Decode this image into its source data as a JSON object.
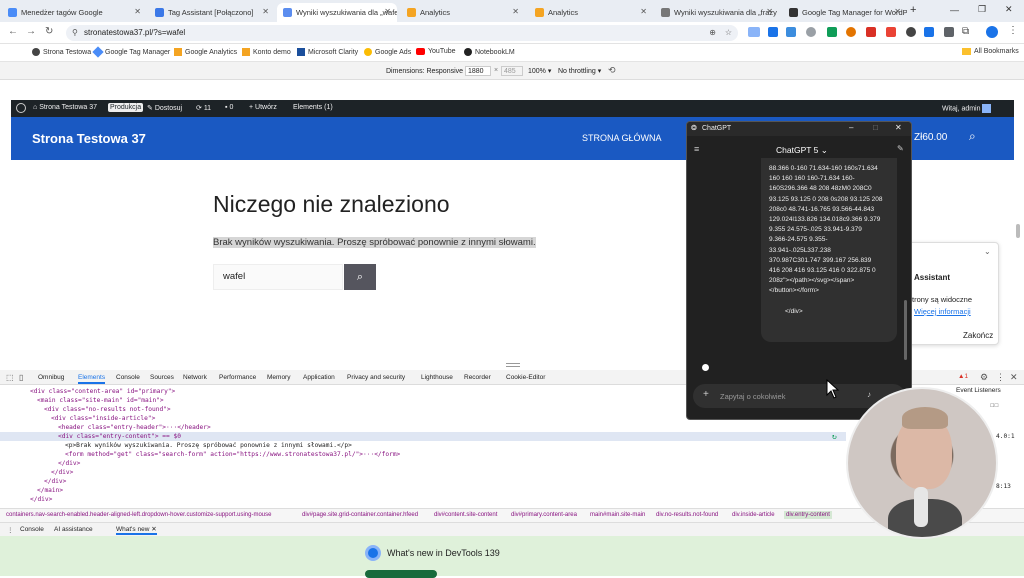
{
  "tabs": [
    {
      "label": "Menedżer tagów Google",
      "color": "#4a8cf7"
    },
    {
      "label": "Tag Assistant [Połączono]",
      "color": "#3b78e7"
    },
    {
      "label": "Wyniki wyszukiwania dla „wafel",
      "color": "#5b8def"
    },
    {
      "label": "Analytics",
      "color": "#f4a422"
    },
    {
      "label": "Analytics",
      "color": "#f4a422"
    },
    {
      "label": "Wyniki wyszukiwania dla „frazy",
      "color": "#777777"
    },
    {
      "label": "Google Tag Manager for WordPr",
      "color": "#333333"
    }
  ],
  "address": {
    "url": "stronatestowa37.pl/?s=wafel"
  },
  "bookmarks": [
    "Strona Testowa",
    "Google Tag Manager",
    "Google Analytics",
    "Konto demo",
    "Microsoft Clarity",
    "Google Ads",
    "YouTube",
    "NotebookLM"
  ],
  "all_bookmarks": "All Bookmarks",
  "device": {
    "dimensions": "Dimensions: Responsive",
    "width": "1880",
    "height": "485",
    "zoom": "100%",
    "throttle": "No throttling"
  },
  "wpbar": {
    "site": "Strona Testowa 37",
    "badge": "Produkcja",
    "customize": "Dostosuj",
    "updates": "11",
    "comments": "0",
    "new": "Utwórz",
    "elements": "Elements (1)",
    "greeting": "Witaj, admin"
  },
  "site": {
    "title": "Strona Testowa 37",
    "nav": "STRONA GŁÓWNA",
    "cart": "Zł60.00"
  },
  "page": {
    "heading": "Niczego nie znaleziono",
    "message": "Brak wyników wyszukiwania. Proszę spróbować ponownie z innymi słowami.",
    "search_value": "wafel"
  },
  "assistant": {
    "title": "Assistant",
    "line1": "trony są widoczne",
    "link": "Więcej informacji",
    "end": "Zakończ"
  },
  "devtools": {
    "tabs": [
      "Omnibug",
      "Elements",
      "Console",
      "Sources",
      "Network",
      "Performance",
      "Memory",
      "Application",
      "Privacy and security",
      "Lighthouse",
      "Recorder",
      "Cookie-Editor"
    ],
    "issues": "1",
    "event_listeners": "Event Listeners",
    "dom_lines": [
      "<div class=\"content-area\" id=\"primary\">",
      "<main class=\"site-main\" id=\"main\">",
      "<div class=\"no-results not-found\">",
      "<div class=\"inside-article\">",
      "<header class=\"entry-header\">···</header>",
      "<div class=\"entry-content\"> == $0",
      "<p>Brak wyników wyszukiwania. Proszę spróbować ponownie z innymi słowami.</p>",
      "<form method=\"get\" class=\"search-form\" action=\"https://www.stronatestowa37.pl/\">···</form>",
      "</div>",
      "</div>",
      "</div>",
      "</main>",
      "</div>"
    ],
    "side_values": [
      "4.0:1",
      "8:13"
    ],
    "breadcrumbs": [
      "containers.nav-search-enabled.header-aligned-left.dropdown-hover.customize-support.using-mouse",
      "div#page.site.grid-container.container.hfeed",
      "div#content.site-content",
      "div#primary.content-area",
      "main#main.site-main",
      "div.no-results.not-found",
      "div.inside-article",
      "div.entry-content"
    ],
    "drawer_tabs": [
      "Console",
      "AI assistance",
      "What's new"
    ],
    "whats_new": "What's new in DevTools 139"
  },
  "chatgpt": {
    "window_title": "ChatGPT",
    "model": "ChatGPT 5",
    "code_lines": [
      "88.366 0-160 71.634-160 160s71.634",
      "160 160 160 160-71.634 160-",
      "160S296.366 48 208 48zM0 208C0",
      "93.125 93.125 0 208 0s208 93.125 208",
      "208c0 48.741-16.765 93.566-44.843",
      "129.024l133.826 134.018c9.366 9.379",
      "9.355 24.575-.025 33.941-9.379",
      "9.366-24.575 9.355-",
      "33.941-.025L337.238",
      "370.987C301.747 399.167 256.839",
      "416 208 416 93.125 416 0 322.875 0",
      "208z\"></path></svg></span>",
      "</button></form>"
    ],
    "closing": "</div>",
    "placeholder": "Zapytaj o cokolwiek"
  }
}
